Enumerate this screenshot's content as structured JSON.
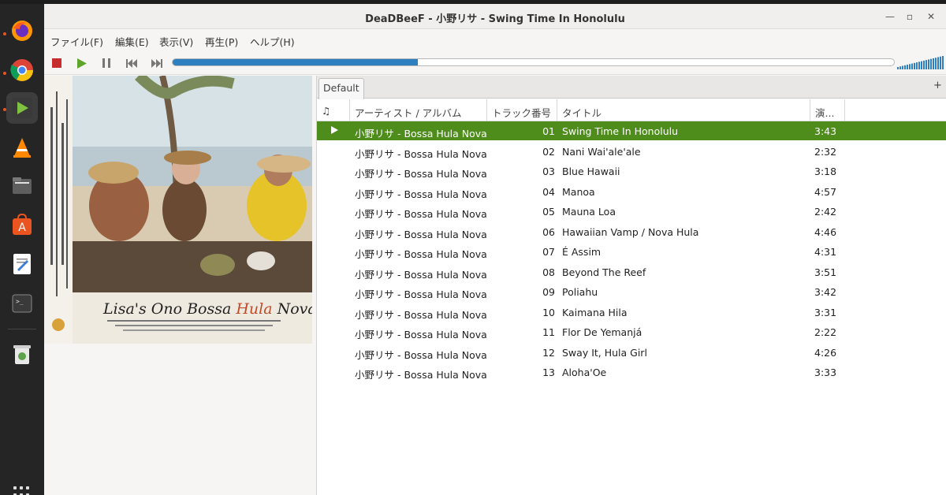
{
  "window": {
    "title": "DeaDBeeF - 小野リサ - Swing Time In Honolulu"
  },
  "menu": [
    "ファイル(F)",
    "編集(E)",
    "表示(V)",
    "再生(P)",
    "ヘルプ(H)"
  ],
  "playback": {
    "progress": 0.34,
    "volume": 1.0
  },
  "album_art": {
    "text": "Lisa's Ono Bossa Hula Nova",
    "text_parts": [
      "Lisa's Ono Bossa ",
      "Hula",
      " Nova"
    ]
  },
  "playlist_tab": {
    "name": "Default",
    "add_label": "+"
  },
  "columns": {
    "playing": "♫",
    "artist": "アーティスト / アルバム",
    "track": "トラック番号",
    "title": "タイトル",
    "duration": "演..."
  },
  "tracks": [
    {
      "artist": "小野リサ - Bossa Hula Nova",
      "num": "01",
      "title": "Swing Time In Honolulu",
      "dur": "3:43",
      "playing": true
    },
    {
      "artist": "小野リサ - Bossa Hula Nova",
      "num": "02",
      "title": "Nani Wai'ale'ale",
      "dur": "2:32"
    },
    {
      "artist": "小野リサ - Bossa Hula Nova",
      "num": "03",
      "title": "Blue Hawaii",
      "dur": "3:18"
    },
    {
      "artist": "小野リサ - Bossa Hula Nova",
      "num": "04",
      "title": "Manoa",
      "dur": "4:57"
    },
    {
      "artist": "小野リサ - Bossa Hula Nova",
      "num": "05",
      "title": "Mauna Loa",
      "dur": "2:42"
    },
    {
      "artist": "小野リサ - Bossa Hula Nova",
      "num": "06",
      "title": "Hawaiian Vamp / Nova Hula",
      "dur": "4:46"
    },
    {
      "artist": "小野リサ - Bossa Hula Nova",
      "num": "07",
      "title": "É Assim",
      "dur": "4:31"
    },
    {
      "artist": "小野リサ - Bossa Hula Nova",
      "num": "08",
      "title": "Beyond The Reef",
      "dur": "3:51"
    },
    {
      "artist": "小野リサ - Bossa Hula Nova",
      "num": "09",
      "title": "Poliahu",
      "dur": "3:42"
    },
    {
      "artist": "小野リサ - Bossa Hula Nova",
      "num": "10",
      "title": "Kaimana Hila",
      "dur": "3:31"
    },
    {
      "artist": "小野リサ - Bossa Hula Nova",
      "num": "11",
      "title": "Flor De Yemanjá",
      "dur": "2:22"
    },
    {
      "artist": "小野リサ - Bossa Hula Nova",
      "num": "12",
      "title": "Sway It, Hula Girl",
      "dur": "4:26"
    },
    {
      "artist": "小野リサ - Bossa Hula Nova",
      "num": "13",
      "title": "Aloha'Oe",
      "dur": "3:33"
    }
  ],
  "dock": [
    "firefox-icon",
    "chrome-icon",
    "deadbeef-icon",
    "vlc-icon",
    "files-icon",
    "software-center-icon",
    "text-editor-icon",
    "terminal-icon",
    "trash-icon",
    "app-grid-icon"
  ],
  "colors": {
    "accent": "#2e7fbf",
    "playing_row": "#4e8d1b",
    "dock_indicator": "#e95420"
  }
}
